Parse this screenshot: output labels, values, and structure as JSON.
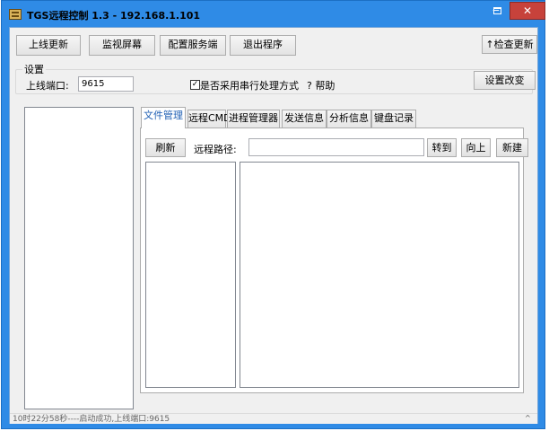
{
  "window": {
    "title": "TGS远程控制 1.3 - 192.168.1.101"
  },
  "toolbar": {
    "buttons": [
      "上线更新",
      "监视屏幕",
      "配置服务端",
      "退出程序"
    ],
    "check_update": "检查更新",
    "check_update_icon": "up-arrow-icon"
  },
  "settings": {
    "group_title": "设置",
    "port_label": "上线端口:",
    "port_value": "9615",
    "serial_checked": true,
    "serial_label": "是否采用串行处理方式",
    "help_label": "帮助",
    "apply_button": "设置改变"
  },
  "tabs": [
    "文件管理",
    "远程CMD",
    "进程管理器",
    "发送信息",
    "分析信息",
    "键盘记录"
  ],
  "active_tab": 0,
  "file_manager": {
    "refresh_button": "刷新",
    "path_label": "远程路径:",
    "path_value": "",
    "goto_button": "转到",
    "up_button": "向上",
    "new_button": "新建"
  },
  "status": {
    "text": "10时22分58秒----启动成功,上线端口:9615"
  }
}
